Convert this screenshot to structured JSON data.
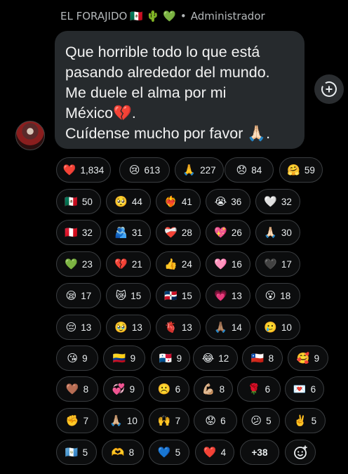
{
  "header": {
    "sender": "EL FORAJIDO",
    "flags": "🇲🇽 🌵 💚",
    "separator": "•",
    "role": "Administrador"
  },
  "message": {
    "lines": [
      "Que horrible todo lo que está",
      "pasando alrededor del mundo.",
      "Me duele el alma por mi",
      "México💔.",
      "Cuídense mucho por favor 🙏🏻."
    ]
  },
  "reactions": [
    [
      "❤️",
      "1,834"
    ],
    [
      "😢",
      "613"
    ],
    [
      "🙏",
      "227"
    ],
    [
      "😞",
      "84"
    ],
    [
      "🤗",
      "59"
    ],
    [
      "🇲🇽",
      "50"
    ],
    [
      "🥺",
      "44"
    ],
    [
      "❤️‍🔥",
      "41"
    ],
    [
      "😭",
      "36"
    ],
    [
      "🤍",
      "32"
    ],
    [
      "🇵🇪",
      "32"
    ],
    [
      "🫂",
      "31"
    ],
    [
      "❤️‍🩹",
      "28"
    ],
    [
      "💖",
      "26"
    ],
    [
      "🙏🏻",
      "30"
    ],
    [
      "💚",
      "23"
    ],
    [
      "💔",
      "21"
    ],
    [
      "👍",
      "24"
    ],
    [
      "🩷",
      "16"
    ],
    [
      "🖤",
      "17"
    ],
    [
      "😪",
      "17"
    ],
    [
      "😿",
      "15"
    ],
    [
      "🇩🇴",
      "15"
    ],
    [
      "💗",
      "13"
    ],
    [
      "😮",
      "18"
    ],
    [
      "😔",
      "13"
    ],
    [
      "🥹",
      "13"
    ],
    [
      "🫀",
      "13"
    ],
    [
      "🙏🏽",
      "14"
    ],
    [
      "🥲",
      "10"
    ],
    [
      "😘",
      "9"
    ],
    [
      "🇨🇴",
      "9"
    ],
    [
      "🇵🇦",
      "9"
    ],
    [
      "😂",
      "12"
    ],
    [
      "🇨🇱",
      "8"
    ],
    [
      "🥰",
      "9"
    ],
    [
      "🤎",
      "8"
    ],
    [
      "💞",
      "9"
    ],
    [
      "☹️",
      "6"
    ],
    [
      "💪🏼",
      "8"
    ],
    [
      "🌹",
      "6"
    ],
    [
      "💌",
      "6"
    ],
    [
      "✊",
      "7"
    ],
    [
      "🙏🏼",
      "10"
    ],
    [
      "🙌",
      "7"
    ],
    [
      "😟",
      "6"
    ],
    [
      "😕",
      "5"
    ],
    [
      "✌️",
      "5"
    ],
    [
      "🇬🇹",
      "5"
    ],
    [
      "🫶",
      "8"
    ],
    [
      "💙",
      "5"
    ],
    [
      "❤️",
      "4"
    ],
    [
      "",
      "+38"
    ],
    [
      "🫥",
      ""
    ]
  ],
  "icons": {
    "add_reaction": "add-reaction-icon",
    "more_emoji": "emoji-add-icon"
  }
}
